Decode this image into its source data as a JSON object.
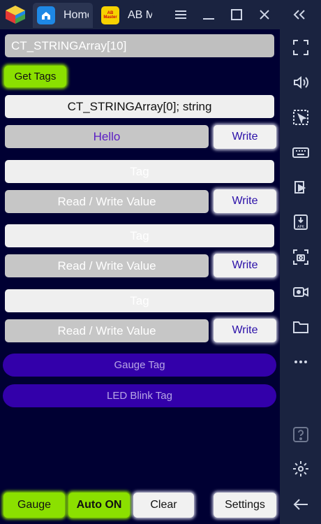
{
  "titlebar": {
    "tabs": [
      {
        "label": "Home",
        "icon": "home-icon"
      },
      {
        "label": "AB Master",
        "icon_text": "AB Master"
      }
    ],
    "controls": [
      "hamburger-menu-icon",
      "minimize-icon",
      "maximize-icon",
      "close-icon",
      "collapse-icon"
    ]
  },
  "app": {
    "array_field": "CT_STRINGArray[10]",
    "get_tags_label": "Get Tags",
    "rows": [
      {
        "tag": "CT_STRINGArray[0]; string",
        "value": "Hello",
        "write_label": "Write"
      },
      {
        "tag_placeholder": "Tag",
        "value_placeholder": "Read / Write Value",
        "write_label": "Write"
      },
      {
        "tag_placeholder": "Tag",
        "value_placeholder": "Read / Write Value",
        "write_label": "Write"
      },
      {
        "tag_placeholder": "Tag",
        "value_placeholder": "Read / Write Value",
        "write_label": "Write"
      }
    ],
    "gauge_tag_label": "Gauge Tag",
    "led_blink_tag_label": "LED Blink Tag",
    "bottom": {
      "gauge": "Gauge",
      "auto_on": "Auto ON",
      "clear": "Clear",
      "settings": "Settings"
    }
  },
  "colors": {
    "app_background": "#000033",
    "green_button": "#8be000",
    "pill_purple": "#3300aa",
    "write_text": "#2a0fa8",
    "titlebar": "#1a2340"
  },
  "sidebar": {
    "icons": [
      "fullscreen-icon",
      "volume-icon",
      "select-cursor-icon",
      "keyboard-icon",
      "media-manager-icon",
      "install-apk-icon",
      "screenshot-icon",
      "screen-record-icon",
      "folder-icon",
      "more-options-icon",
      "help-icon",
      "settings-gear-icon",
      "back-arrow-icon"
    ]
  }
}
